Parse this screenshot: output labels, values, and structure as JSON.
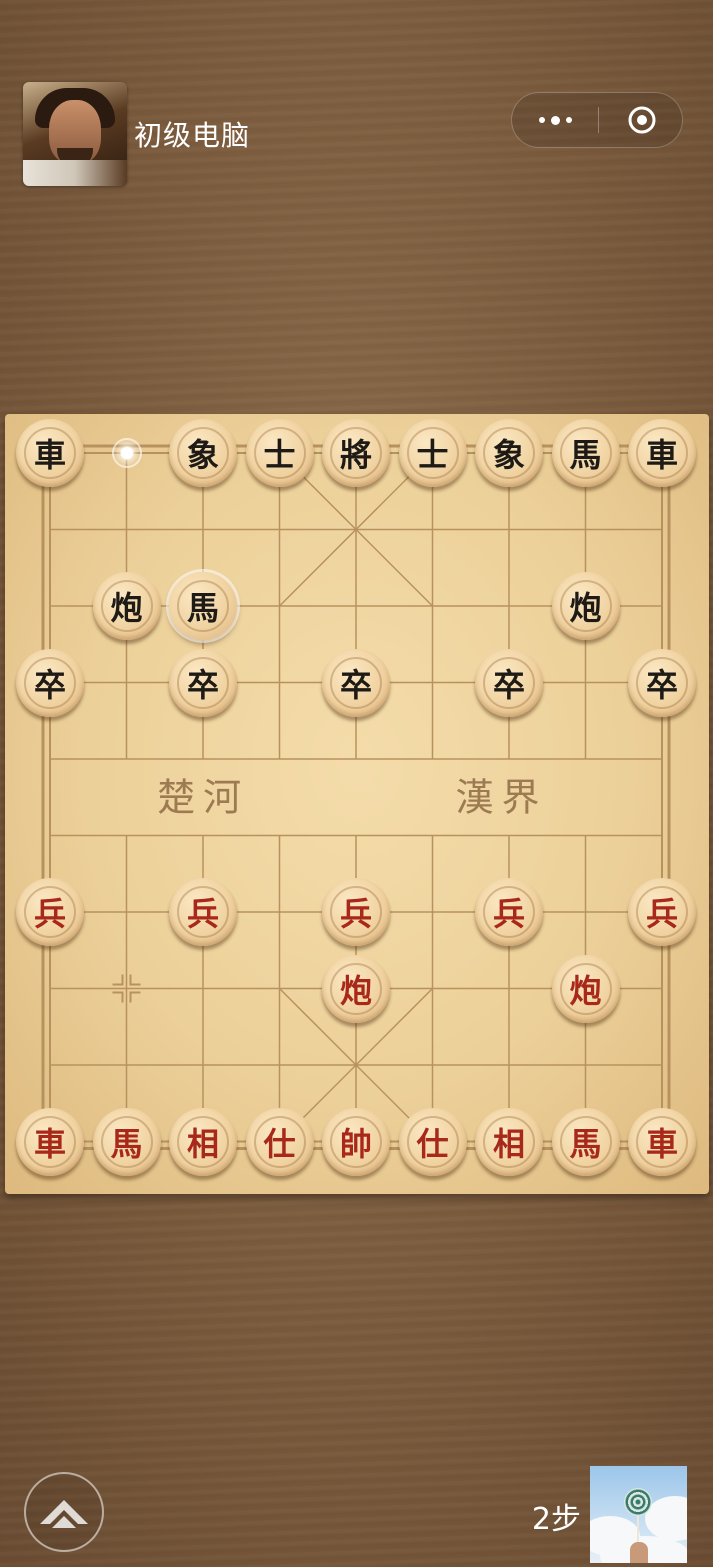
{
  "header": {
    "opponent_name": "初级电脑",
    "opponent_avatar_icon": "warrior-portrait-icon",
    "menu_icon": "more-dots-icon",
    "close_icon": "target-circle-icon"
  },
  "board": {
    "river_left": "楚河",
    "river_right": "漢界",
    "files": 9,
    "ranks": 10,
    "colors": {
      "black_text": "#1e1a16",
      "red_text": "#a8281a",
      "board": "#ecd099"
    },
    "pieces": [
      {
        "side": "black",
        "char": "車",
        "file": 0,
        "rank": 0
      },
      {
        "side": "black",
        "char": "象",
        "file": 2,
        "rank": 0
      },
      {
        "side": "black",
        "char": "士",
        "file": 3,
        "rank": 0
      },
      {
        "side": "black",
        "char": "將",
        "file": 4,
        "rank": 0
      },
      {
        "side": "black",
        "char": "士",
        "file": 5,
        "rank": 0
      },
      {
        "side": "black",
        "char": "象",
        "file": 6,
        "rank": 0
      },
      {
        "side": "black",
        "char": "馬",
        "file": 7,
        "rank": 0
      },
      {
        "side": "black",
        "char": "車",
        "file": 8,
        "rank": 0
      },
      {
        "side": "black",
        "char": "炮",
        "file": 1,
        "rank": 2
      },
      {
        "side": "black",
        "char": "馬",
        "file": 2,
        "rank": 2,
        "selected": true
      },
      {
        "side": "black",
        "char": "炮",
        "file": 7,
        "rank": 2
      },
      {
        "side": "black",
        "char": "卒",
        "file": 0,
        "rank": 3
      },
      {
        "side": "black",
        "char": "卒",
        "file": 2,
        "rank": 3
      },
      {
        "side": "black",
        "char": "卒",
        "file": 4,
        "rank": 3
      },
      {
        "side": "black",
        "char": "卒",
        "file": 6,
        "rank": 3
      },
      {
        "side": "black",
        "char": "卒",
        "file": 8,
        "rank": 3
      },
      {
        "side": "red",
        "char": "兵",
        "file": 0,
        "rank": 6
      },
      {
        "side": "red",
        "char": "兵",
        "file": 2,
        "rank": 6
      },
      {
        "side": "red",
        "char": "兵",
        "file": 4,
        "rank": 6
      },
      {
        "side": "red",
        "char": "兵",
        "file": 6,
        "rank": 6
      },
      {
        "side": "red",
        "char": "兵",
        "file": 8,
        "rank": 6
      },
      {
        "side": "red",
        "char": "炮",
        "file": 4,
        "rank": 7
      },
      {
        "side": "red",
        "char": "炮",
        "file": 7,
        "rank": 7
      },
      {
        "side": "red",
        "char": "車",
        "file": 0,
        "rank": 9
      },
      {
        "side": "red",
        "char": "馬",
        "file": 1,
        "rank": 9
      },
      {
        "side": "red",
        "char": "相",
        "file": 2,
        "rank": 9
      },
      {
        "side": "red",
        "char": "仕",
        "file": 3,
        "rank": 9
      },
      {
        "side": "red",
        "char": "帥",
        "file": 4,
        "rank": 9
      },
      {
        "side": "red",
        "char": "仕",
        "file": 5,
        "rank": 9
      },
      {
        "side": "red",
        "char": "相",
        "file": 6,
        "rank": 9
      },
      {
        "side": "red",
        "char": "馬",
        "file": 7,
        "rank": 9
      },
      {
        "side": "red",
        "char": "車",
        "file": 8,
        "rank": 9
      }
    ],
    "last_move_from": {
      "file": 1,
      "rank": 0
    },
    "last_move_marker": {
      "file": 1,
      "rank": 7
    }
  },
  "footer": {
    "home_icon": "home-up-arrow-icon",
    "steps_label": "2步",
    "player_avatar_icon": "lollipop-sky-avatar-icon"
  }
}
